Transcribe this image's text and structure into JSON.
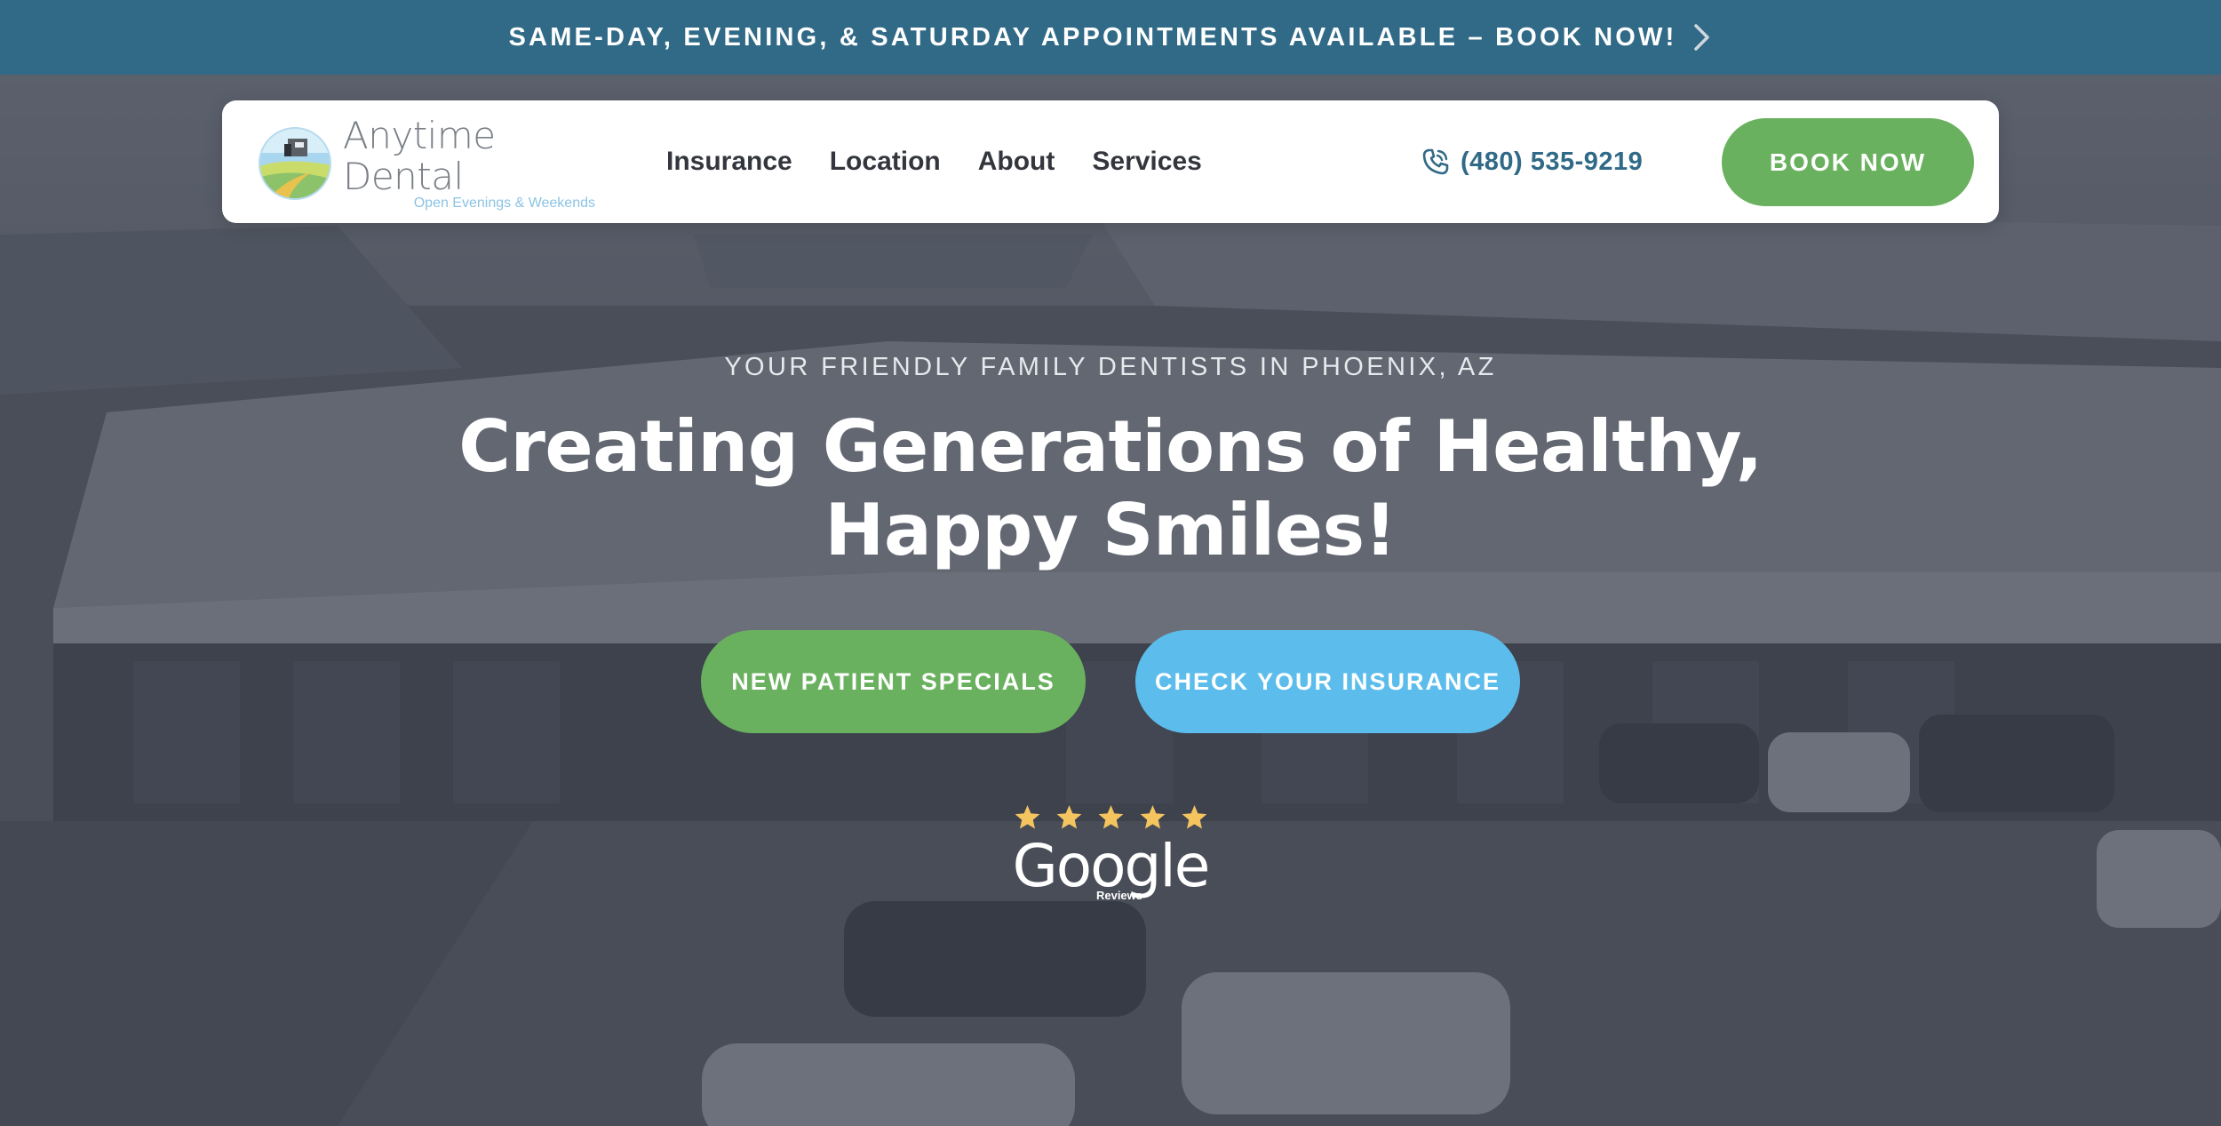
{
  "announcement": {
    "text": "SAME-DAY, EVENING, & SATURDAY APPOINTMENTS AVAILABLE – BOOK NOW!",
    "icon": "chevron-right-icon"
  },
  "header": {
    "logo": {
      "name": "Anytime Dental",
      "tagline": "Open Evenings & Weekends"
    },
    "nav": [
      {
        "label": "Insurance"
      },
      {
        "label": "Location"
      },
      {
        "label": "About"
      },
      {
        "label": "Services"
      }
    ],
    "phone": {
      "number": "(480) 535-9219",
      "icon": "phone-icon"
    },
    "book_label": "BOOK NOW"
  },
  "hero": {
    "eyebrow": "YOUR FRIENDLY FAMILY DENTISTS IN PHOENIX, AZ",
    "headline_line1": "Creating Generations of Healthy,",
    "headline_line2": "Happy Smiles!",
    "cta_primary": "NEW PATIENT SPECIALS",
    "cta_secondary": "CHECK YOUR INSURANCE",
    "reviews": {
      "rating": 5,
      "max_rating": 5,
      "brand": "Google",
      "label": "Reviews"
    }
  },
  "colors": {
    "announcement_bg": "#316a87",
    "primary_green": "#6ab15f",
    "accent_blue": "#5cbdec",
    "phone_blue": "#316a87",
    "star_gold": "#f4c45f",
    "nav_text": "#33363d"
  }
}
